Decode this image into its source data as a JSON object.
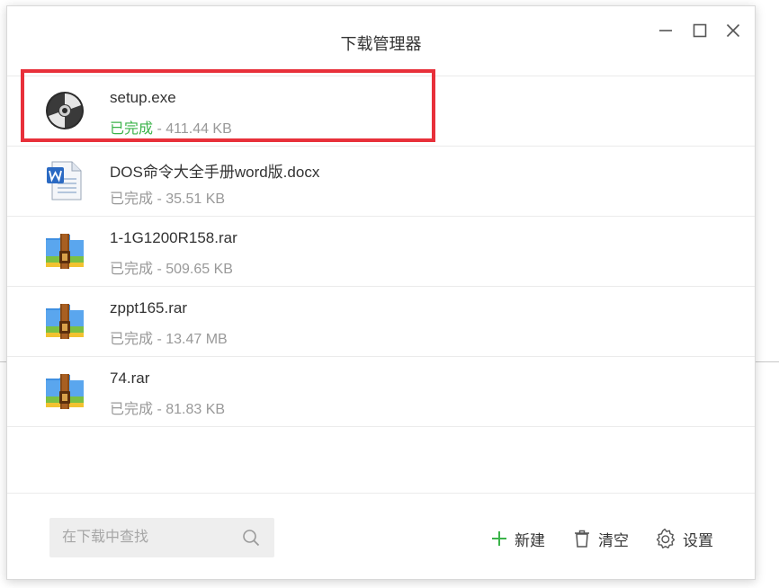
{
  "window": {
    "title": "下载管理器"
  },
  "window_controls": {
    "minimize_icon": "minimize-icon",
    "maximize_icon": "maximize-icon",
    "close_icon": "close-icon"
  },
  "downloads": [
    {
      "name": "setup.exe",
      "status": "已完成",
      "separator": " - ",
      "size": "411.44 KB",
      "icon": "disc-installer-icon",
      "status_color": "#3bb34a"
    },
    {
      "name": "DOS命令大全手册word版.docx",
      "status": "已完成",
      "separator": " - ",
      "size": "35.51 KB",
      "icon": "word-document-icon",
      "status_color": "#999999"
    },
    {
      "name": "1-1G1200R158.rar",
      "status": "已完成",
      "separator": " - ",
      "size": "509.65 KB",
      "icon": "rar-archive-icon",
      "status_color": "#999999"
    },
    {
      "name": "zppt165.rar",
      "status": "已完成",
      "separator": " - ",
      "size": "13.47 MB",
      "icon": "rar-archive-icon",
      "status_color": "#999999"
    },
    {
      "name": "74.rar",
      "status": "已完成",
      "separator": " - ",
      "size": "81.83 KB",
      "icon": "rar-archive-icon",
      "status_color": "#999999"
    }
  ],
  "footer": {
    "search_placeholder": "在下载中查找",
    "new_label": "新建",
    "clear_label": "清空",
    "settings_label": "设置"
  },
  "colors": {
    "accent_green": "#3bb34a",
    "highlight_red": "#e8303a"
  }
}
